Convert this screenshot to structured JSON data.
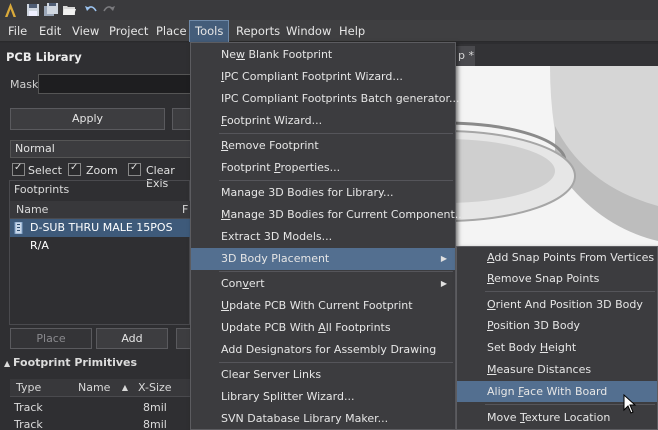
{
  "menubar": {
    "items": [
      "File",
      "Edit",
      "View",
      "Project",
      "Place",
      "Tools",
      "Reports",
      "Window",
      "Help"
    ]
  },
  "panel": {
    "title": "PCB Library",
    "mask_label": "Mask",
    "apply_label": "Apply",
    "mode_value": "Normal",
    "checks": [
      "Select",
      "Zoom",
      "Clear Exis"
    ],
    "footprints_header": "Footprints",
    "col_name": "Name",
    "col_extra": "F",
    "selected_footprint": "D-SUB THRU MALE 15POS R/A",
    "place_label": "Place",
    "add_label": "Add",
    "primitives_header": "Footprint Primitives",
    "prim_cols": [
      "Type",
      "Name",
      "X-Size"
    ],
    "prim_rows": [
      {
        "type": "Track",
        "size": "8mil"
      },
      {
        "type": "Track",
        "size": "8mil"
      }
    ]
  },
  "doc_tab": "p *",
  "tools_menu": [
    {
      "pre": "Ne",
      "u": "w",
      "post": " Blank Footprint"
    },
    {
      "pre": "",
      "u": "I",
      "post": "PC Compliant Footprint Wizard..."
    },
    {
      "pre": "IPC Compliant Footprints Batch generator...",
      "u": "",
      "post": ""
    },
    {
      "pre": "",
      "u": "F",
      "post": "ootprint Wizard..."
    },
    {
      "pre": "",
      "u": "R",
      "post": "emove Footprint"
    },
    {
      "pre": "Footprint ",
      "u": "P",
      "post": "roperties..."
    },
    {
      "pre": "Manage 3D Bodies for Library...",
      "u": "",
      "post": ""
    },
    {
      "pre": "",
      "u": "M",
      "post": "anage 3D Bodies for Current Component..."
    },
    {
      "pre": "Extract 3D Models...",
      "u": "",
      "post": ""
    },
    {
      "pre": "3D Body Placement",
      "u": "",
      "post": ""
    },
    {
      "pre": "Con",
      "u": "v",
      "post": "ert"
    },
    {
      "pre": "",
      "u": "U",
      "post": "pdate PCB With Current Footprint"
    },
    {
      "pre": "Update PCB With ",
      "u": "A",
      "post": "ll Footprints"
    },
    {
      "pre": "Add Designators for Assembly Drawing",
      "u": "",
      "post": ""
    },
    {
      "pre": "Clear Server Links",
      "u": "",
      "post": ""
    },
    {
      "pre": "Library Splitter Wizard...",
      "u": "",
      "post": ""
    },
    {
      "pre": "SVN Database Library Maker...",
      "u": "",
      "post": ""
    }
  ],
  "sub_menu": [
    {
      "pre": "",
      "u": "A",
      "post": "dd Snap Points From Vertices"
    },
    {
      "pre": "",
      "u": "R",
      "post": "emove Snap Points"
    },
    {
      "pre": "",
      "u": "O",
      "post": "rient And Position 3D Body"
    },
    {
      "pre": "",
      "u": "P",
      "post": "osition 3D Body"
    },
    {
      "pre": "Set Body ",
      "u": "H",
      "post": "eight"
    },
    {
      "pre": "",
      "u": "M",
      "post": "easure Distances"
    },
    {
      "pre": "Align ",
      "u": "F",
      "post": "ace With Board"
    },
    {
      "pre": "Move ",
      "u": "T",
      "post": "exture Location"
    }
  ]
}
